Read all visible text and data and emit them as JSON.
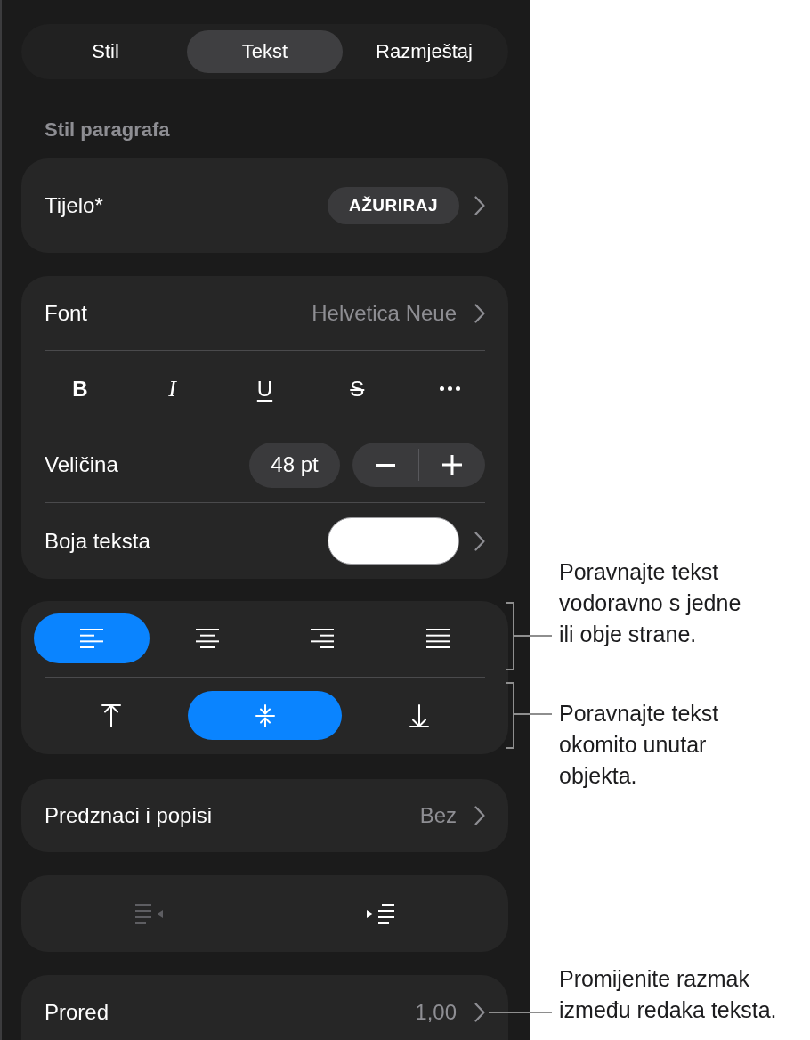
{
  "tabs": [
    {
      "label": "Stil",
      "selected": false
    },
    {
      "label": "Tekst",
      "selected": true
    },
    {
      "label": "Razmještaj",
      "selected": false
    }
  ],
  "section_title": "Stil paragrafa",
  "paragraph_style": {
    "name": "Tijelo*",
    "button": "AŽURIRAJ"
  },
  "font": {
    "label": "Font",
    "value": "Helvetica Neue"
  },
  "style_buttons": [
    {
      "kind": "bold",
      "label": "B"
    },
    {
      "kind": "italic",
      "label": "I"
    },
    {
      "kind": "underline",
      "label": "U"
    },
    {
      "kind": "strikethrough",
      "label": "S"
    },
    {
      "kind": "more"
    }
  ],
  "size": {
    "label": "Veličina",
    "value": "48 pt"
  },
  "text_color": {
    "label": "Boja teksta",
    "color": "#ffffff"
  },
  "horizontal_alignment": [
    {
      "kind": "left",
      "selected": true
    },
    {
      "kind": "center",
      "selected": false
    },
    {
      "kind": "right",
      "selected": false
    },
    {
      "kind": "justify",
      "selected": false
    }
  ],
  "vertical_alignment": [
    {
      "kind": "top",
      "selected": false
    },
    {
      "kind": "middle",
      "selected": true
    },
    {
      "kind": "bottom",
      "selected": false
    }
  ],
  "bullets": {
    "label": "Predznaci i popisi",
    "value": "Bez"
  },
  "indent_buttons": [
    {
      "kind": "decrease",
      "disabled": true
    },
    {
      "kind": "increase",
      "disabled": false
    }
  ],
  "line_spacing": {
    "label": "Prored",
    "value": "1,00"
  },
  "callouts": [
    {
      "kind": "bracket",
      "text": "Poravnajte tekst vodoravno s jedne ili obje strane."
    },
    {
      "kind": "bracket",
      "text": "Poravnajte tekst okomito unutar objekta."
    },
    {
      "kind": "line",
      "text": "Promijenite razmak između redaka teksta."
    }
  ]
}
